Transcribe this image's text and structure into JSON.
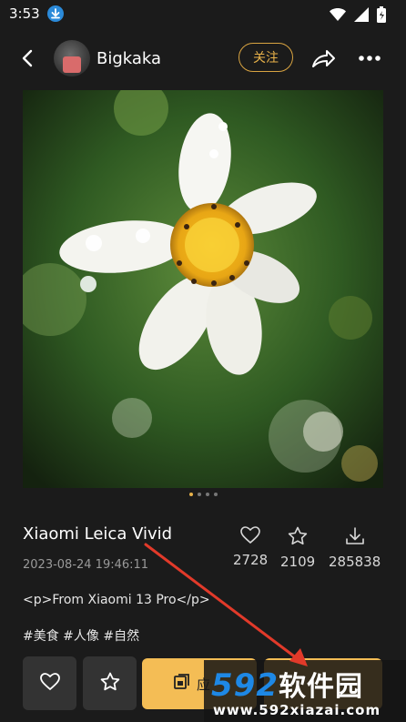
{
  "status_bar": {
    "time": "3:53"
  },
  "header": {
    "username": "Bigkaka",
    "follow_label": "关注"
  },
  "carousel": {
    "page_count": 4,
    "active_index": 0
  },
  "post": {
    "title": "Xiaomi Leica Vivid",
    "datetime": "2023-08-24 19:46:11",
    "description": "<p>From Xiaomi 13 Pro</p>",
    "tags": "#美食 #人像 #自然"
  },
  "stats": {
    "likes": "2728",
    "favorites": "2109",
    "downloads": "285838"
  },
  "actions": {
    "main_label": "应"
  },
  "watermark": {
    "brand_num": "592",
    "brand_cn": "软件园",
    "url": "www.592xiazai.com"
  },
  "colors": {
    "accent": "#f4bd55",
    "follow": "#e8b24a",
    "background": "#1b1b1b"
  }
}
